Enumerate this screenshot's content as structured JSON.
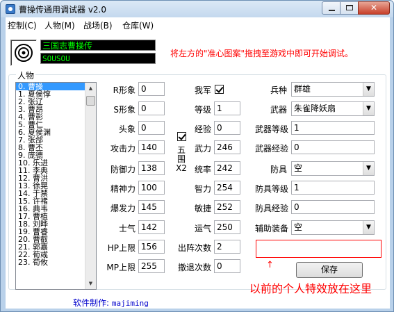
{
  "window": {
    "title": "曹操传通用调试器 v2.0",
    "min_label": "",
    "max_label": "",
    "close_label": "✕"
  },
  "menu": [
    {
      "label": "控制(C)"
    },
    {
      "label": "人物(M)"
    },
    {
      "label": "战场(B)"
    },
    {
      "label": "仓库(W)"
    }
  ],
  "header": {
    "game_name": "三国志曹操传",
    "game_code": "SOUSOU",
    "hint": "将左方的\"准心图案\"拖拽至游戏中即可开始调试。"
  },
  "group": {
    "title": "人物"
  },
  "characters": [
    "0. 曹操",
    "1. 夏侯惇",
    "2. 张辽",
    "3. 曹昂",
    "4. 曹彰",
    "5. 曹仁",
    "6. 夏侯渊",
    "7. 张郃",
    "8. 曹丕",
    "9. 庞德",
    "10. 乐进",
    "11. 李典",
    "12. 曹洪",
    "13. 徐晃",
    "14. 于禁",
    "15. 许褚",
    "16. 典韦",
    "17. 曹植",
    "18. 刘晔",
    "19. 曹睿",
    "20. 曹叡",
    "21. 郭嘉",
    "22. 荀彧",
    "23. 荀攸"
  ],
  "selected_character_index": 0,
  "fields_col1": [
    {
      "label": "R形象",
      "value": "0"
    },
    {
      "label": "S形象",
      "value": "0"
    },
    {
      "label": "头象",
      "value": "0"
    },
    {
      "label": "攻击力",
      "value": "140"
    },
    {
      "label": "防御力",
      "value": "138"
    },
    {
      "label": "精神力",
      "value": "100"
    },
    {
      "label": "爆发力",
      "value": "145"
    },
    {
      "label": "士气",
      "value": "142"
    },
    {
      "label": "HP上限",
      "value": "156"
    },
    {
      "label": "MP上限",
      "value": "255"
    }
  ],
  "fields_col2": [
    {
      "label": "我军",
      "value": ""
    },
    {
      "label": "等级",
      "value": "1"
    },
    {
      "label": "经验",
      "value": "0"
    },
    {
      "label": "武力",
      "value": "246"
    },
    {
      "label": "统率",
      "value": "242"
    },
    {
      "label": "智力",
      "value": "254"
    },
    {
      "label": "敏捷",
      "value": "252"
    },
    {
      "label": "运气",
      "value": "250"
    },
    {
      "label": "出阵次数",
      "value": "2"
    },
    {
      "label": "撤退次数",
      "value": "0"
    }
  ],
  "ally_checked": true,
  "five_state": {
    "checked": true,
    "label": "五围X2"
  },
  "fields_col3": {
    "bingzhong": {
      "label": "兵种",
      "value": "群雄"
    },
    "weapon": {
      "label": "武器",
      "value": "朱雀降妖扇"
    },
    "weapon_level": {
      "label": "武器等级",
      "value": "1"
    },
    "weapon_exp": {
      "label": "武器经验",
      "value": "0"
    },
    "armor": {
      "label": "防具",
      "value": "空"
    },
    "armor_level": {
      "label": "防具等级",
      "value": "1"
    },
    "armor_exp": {
      "label": "防具经验",
      "value": "0"
    },
    "accessory": {
      "label": "辅助装备",
      "value": "空"
    }
  },
  "special_arrow": "↑",
  "save_label": "保存",
  "annotation": "以前的个人特效放在这里",
  "credit": {
    "label": "软件制作:",
    "name": "majiming"
  },
  "colors": {
    "accent_red": "#ff0000",
    "credit_blue": "#0000cc",
    "lcd_green": "#00ff00",
    "list_selection": "#3399ff"
  }
}
